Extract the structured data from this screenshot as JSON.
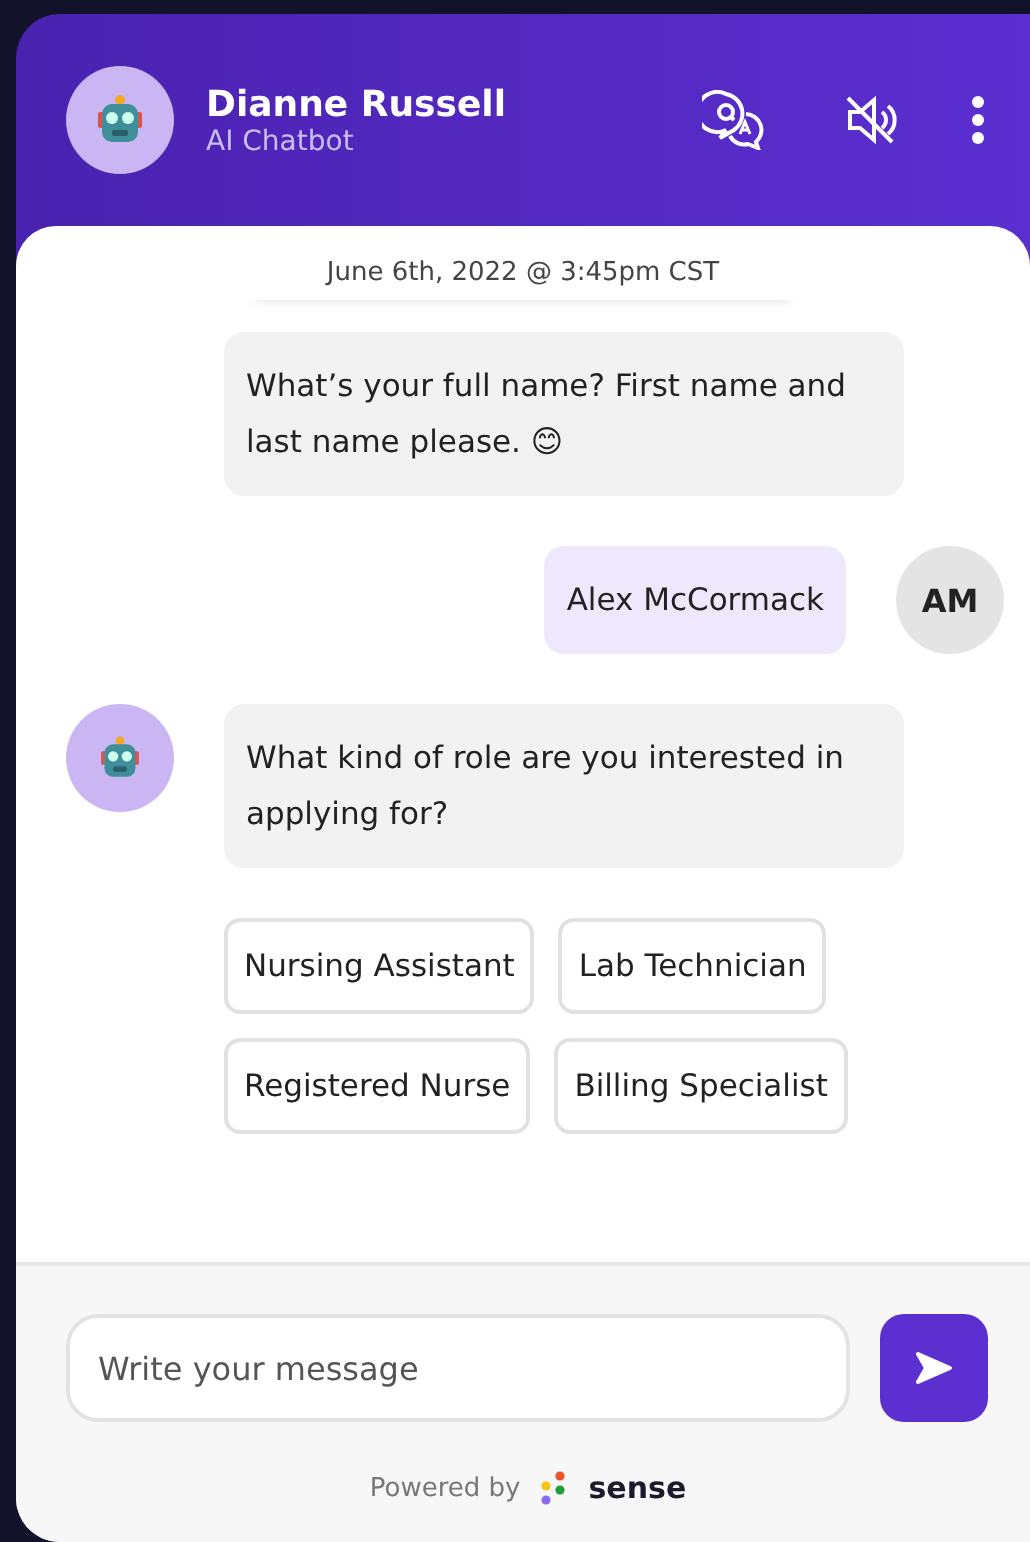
{
  "header": {
    "name": "Dianne Russell",
    "subtitle": "AI Chatbot"
  },
  "timestamp": "June 6th, 2022 @ 3:45pm CST",
  "messages": [
    {
      "kind": "bot",
      "text": "What’s your full name? First name and last name please. 😊",
      "avatar": false
    },
    {
      "kind": "user",
      "text": "Alex McCormack",
      "initials": "AM"
    },
    {
      "kind": "bot",
      "text": "What kind of role are you interested in applying for?",
      "avatar": true
    }
  ],
  "options": [
    {
      "label": "Nursing Assistant"
    },
    {
      "label": "Lab Technician"
    },
    {
      "label": "Registered Nurse"
    },
    {
      "label": "Billing Specialist"
    }
  ],
  "composer": {
    "placeholder": "Write your message"
  },
  "footer": {
    "powered_by": "Powered by",
    "brand": "sense"
  }
}
